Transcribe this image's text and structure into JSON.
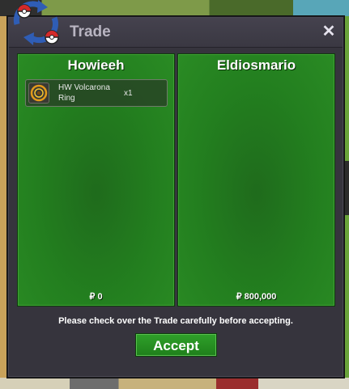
{
  "window": {
    "title": "Trade",
    "close_label": "✕"
  },
  "left_panel": {
    "player_name": "Howieeh",
    "items": [
      {
        "name": "HW Volcarona Ring",
        "quantity": "x1",
        "icon": "ring-icon"
      }
    ],
    "money": "₽ 0"
  },
  "right_panel": {
    "player_name": "Eldiosmario",
    "items": [],
    "money": "₽ 800,000"
  },
  "footer": {
    "notice": "Please check over the Trade carefully before accepting.",
    "accept_label": "Accept"
  },
  "colors": {
    "panel_green": "#237f1f",
    "accept_green": "#2fa12a",
    "window_bg": "#36343d"
  }
}
